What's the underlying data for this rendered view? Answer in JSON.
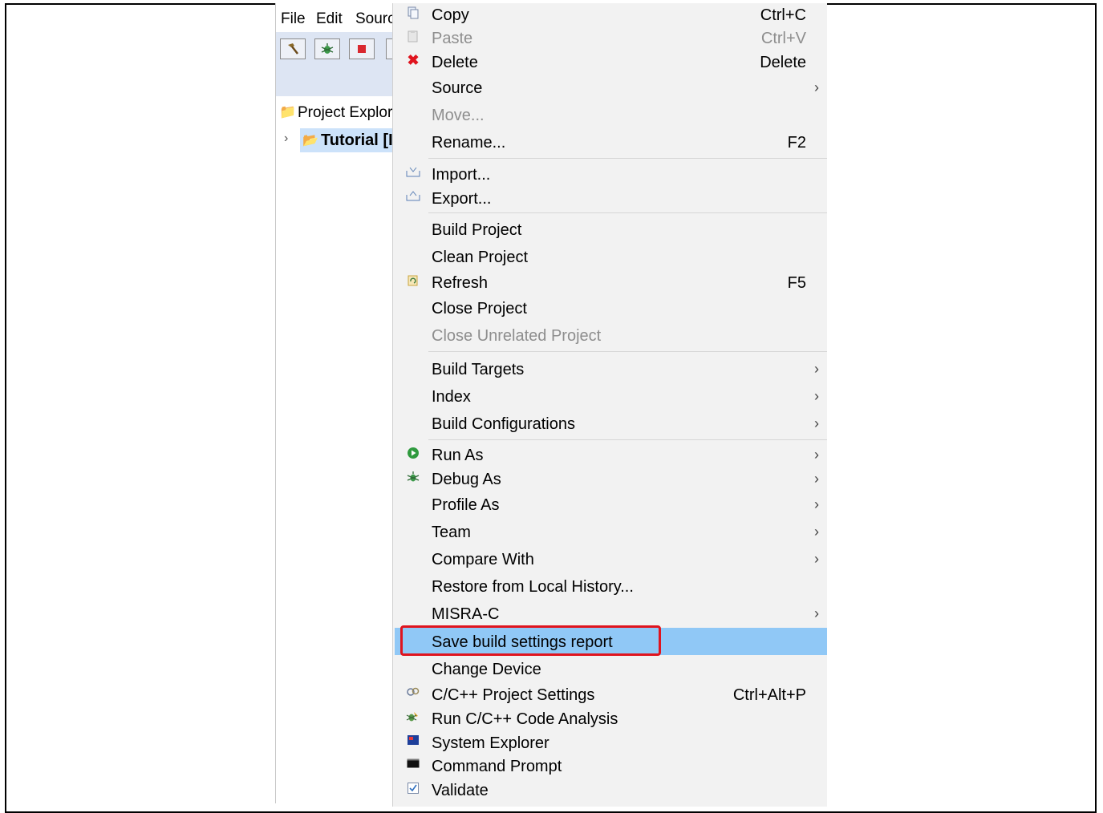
{
  "ide": {
    "menubar": [
      "File",
      "Edit",
      "Sourc"
    ],
    "toolbar_icons": [
      "hammer-icon",
      "bug-icon",
      "stop-icon"
    ],
    "explorer_title": "Project Explor",
    "tree_item": "Tutorial [I"
  },
  "context_menu": {
    "items": [
      {
        "label": "Copy",
        "shortcut": "Ctrl+C",
        "icon": "copy-icon",
        "enabled": true
      },
      {
        "label": "Paste",
        "shortcut": "Ctrl+V",
        "icon": "paste-icon",
        "enabled": false
      },
      {
        "label": "Delete",
        "shortcut": "Delete",
        "icon": "delete-icon",
        "enabled": true
      },
      {
        "label": "Source",
        "submenu": true,
        "enabled": true
      },
      {
        "label": "Move...",
        "enabled": false
      },
      {
        "label": "Rename...",
        "shortcut": "F2",
        "enabled": true
      },
      {
        "label": "Import...",
        "icon": "import-icon",
        "enabled": true
      },
      {
        "label": "Export...",
        "icon": "export-icon",
        "enabled": true
      },
      {
        "label": "Build Project",
        "enabled": true
      },
      {
        "label": "Clean Project",
        "enabled": true
      },
      {
        "label": "Refresh",
        "shortcut": "F5",
        "icon": "refresh-icon",
        "enabled": true
      },
      {
        "label": "Close Project",
        "enabled": true
      },
      {
        "label": "Close Unrelated Project",
        "enabled": false
      },
      {
        "label": "Build Targets",
        "submenu": true,
        "enabled": true
      },
      {
        "label": "Index",
        "submenu": true,
        "enabled": true
      },
      {
        "label": "Build Configurations",
        "submenu": true,
        "enabled": true
      },
      {
        "label": "Run As",
        "submenu": true,
        "icon": "run-icon",
        "enabled": true
      },
      {
        "label": "Debug As",
        "submenu": true,
        "icon": "debug-icon",
        "enabled": true
      },
      {
        "label": "Profile As",
        "submenu": true,
        "enabled": true
      },
      {
        "label": "Team",
        "submenu": true,
        "enabled": true
      },
      {
        "label": "Compare With",
        "submenu": true,
        "enabled": true
      },
      {
        "label": "Restore from Local History...",
        "enabled": true
      },
      {
        "label": "MISRA-C",
        "submenu": true,
        "enabled": true
      },
      {
        "label": "Save build settings report",
        "enabled": true,
        "highlighted": true
      },
      {
        "label": "Change Device",
        "enabled": true
      },
      {
        "label": "C/C++ Project Settings",
        "shortcut": "Ctrl+Alt+P",
        "icon": "settings-icon",
        "enabled": true
      },
      {
        "label": "Run C/C++ Code Analysis",
        "icon": "analysis-icon",
        "enabled": true
      },
      {
        "label": "System Explorer",
        "icon": "system-explorer-icon",
        "enabled": true
      },
      {
        "label": "Command Prompt",
        "icon": "command-prompt-icon",
        "enabled": true
      },
      {
        "label": "Validate",
        "icon": "validate-icon",
        "enabled": true
      }
    ]
  },
  "colors": {
    "highlight": "#90c8f6",
    "annotation_box": "#e0141e",
    "disabled_text": "#8e8e8e"
  }
}
